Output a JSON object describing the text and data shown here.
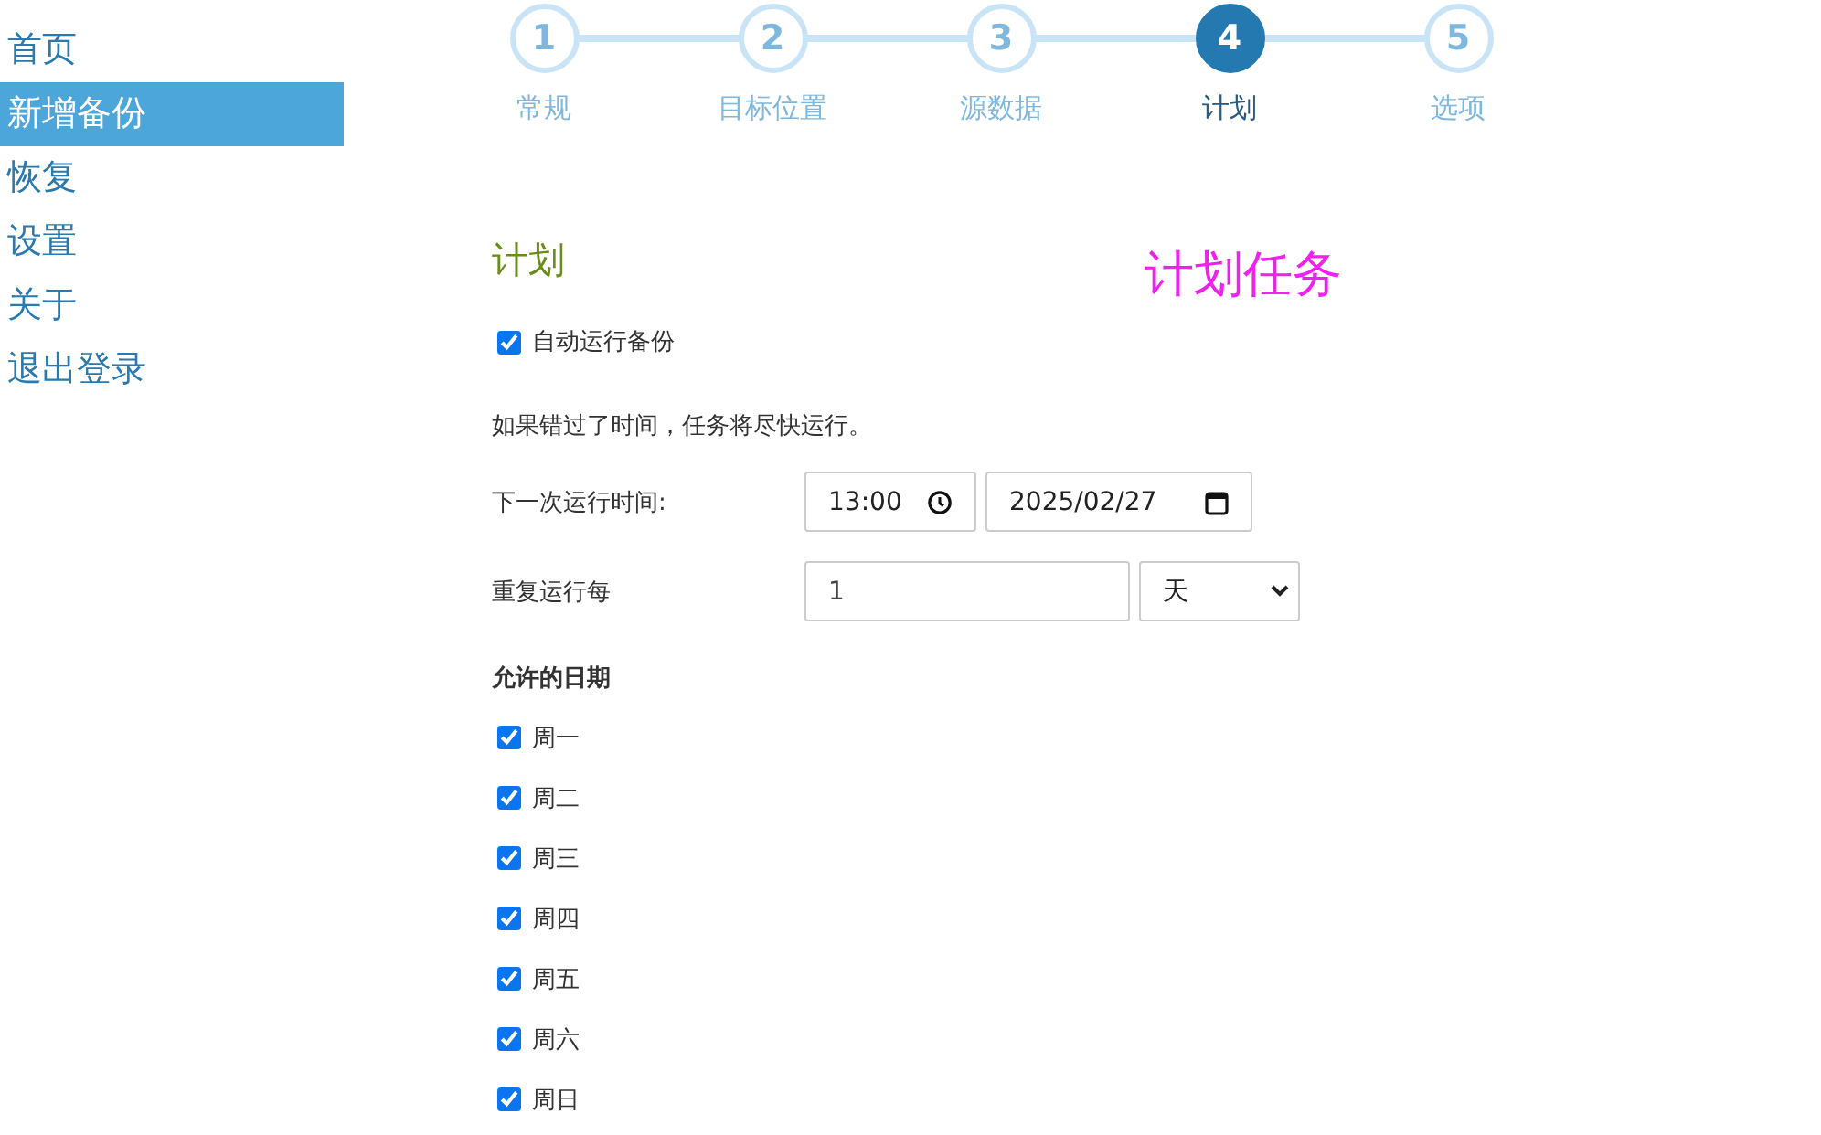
{
  "sidebar": {
    "items": [
      {
        "label": "首页",
        "selected": false
      },
      {
        "label": "新增备份",
        "selected": true
      },
      {
        "label": "恢复",
        "selected": false
      },
      {
        "label": "设置",
        "selected": false
      },
      {
        "label": "关于",
        "selected": false
      },
      {
        "label": "退出登录",
        "selected": false
      }
    ]
  },
  "steps": [
    {
      "number": "1",
      "label": "常规",
      "selected": false
    },
    {
      "number": "2",
      "label": "目标位置",
      "selected": false
    },
    {
      "number": "3",
      "label": "源数据",
      "selected": false
    },
    {
      "number": "4",
      "label": "计划",
      "selected": true
    },
    {
      "number": "5",
      "label": "选项",
      "selected": false
    }
  ],
  "heading": "计划",
  "annotation": "计划任务",
  "auto_run": {
    "label": "自动运行备份",
    "checked": true
  },
  "note": "如果错过了时间，任务将尽快运行。",
  "next_run": {
    "label": "下一次运行时间:",
    "time": "13:00",
    "date": "2025/02/27"
  },
  "repeat": {
    "label": "重复运行每",
    "value": "1",
    "unit": "天"
  },
  "allowed_days": {
    "title": "允许的日期",
    "days": [
      {
        "label": "周一",
        "checked": true
      },
      {
        "label": "周二",
        "checked": true
      },
      {
        "label": "周三",
        "checked": true
      },
      {
        "label": "周四",
        "checked": true
      },
      {
        "label": "周五",
        "checked": true
      },
      {
        "label": "周六",
        "checked": true
      },
      {
        "label": "周日",
        "checked": true
      }
    ]
  }
}
